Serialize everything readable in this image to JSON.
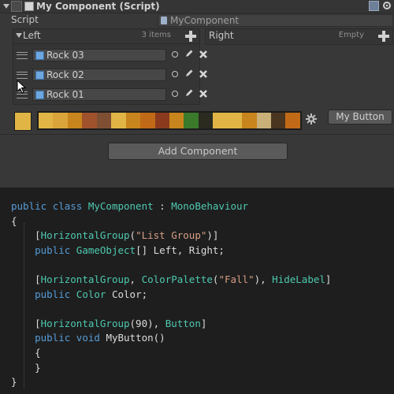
{
  "inspector": {
    "component_title": "My Component (Script)",
    "script_label": "Script",
    "script_value": "MyComponent",
    "left_list": {
      "title": "Left",
      "count": "3 items",
      "items": [
        {
          "label": "Rock 03"
        },
        {
          "label": "Rock 02"
        },
        {
          "label": "Rock 01"
        }
      ]
    },
    "right_list": {
      "title": "Right",
      "count": "Empty"
    },
    "color_field": {
      "value": "#e0b546"
    },
    "palette_colors": [
      "#e0b546",
      "#d9a43a",
      "#c8841d",
      "#a0522d",
      "#7f4f34",
      "#e0b546",
      "#c8841d",
      "#c06a18",
      "#8b3a1e",
      "#c8841d",
      "#3a7a2a",
      "#2b2b20",
      "#e0b546",
      "#e0b546",
      "#c8841d",
      "#c8b078",
      "#4a3520",
      "#c06a18"
    ],
    "my_button_label": "My Button",
    "add_component_label": "Add Component"
  },
  "code": {
    "lines": [
      [
        {
          "t": "public ",
          "c": "kw"
        },
        {
          "t": "class ",
          "c": "kw"
        },
        {
          "t": "MyComponent",
          "c": "ty"
        },
        {
          "t": " : ",
          "c": ""
        },
        {
          "t": "MonoBehaviour",
          "c": "ty"
        }
      ],
      [
        {
          "t": "{",
          "c": ""
        }
      ],
      [
        {
          "t": "    [",
          "c": ""
        },
        {
          "t": "HorizontalGroup",
          "c": "ty"
        },
        {
          "t": "(",
          "c": ""
        },
        {
          "t": "\"List Group\"",
          "c": "str"
        },
        {
          "t": ")]",
          "c": ""
        }
      ],
      [
        {
          "t": "    ",
          "c": ""
        },
        {
          "t": "public ",
          "c": "kw"
        },
        {
          "t": "GameObject",
          "c": "ty"
        },
        {
          "t": "[] Left, Right;",
          "c": ""
        }
      ],
      [
        {
          "t": "",
          "c": ""
        }
      ],
      [
        {
          "t": "    [",
          "c": ""
        },
        {
          "t": "HorizontalGroup",
          "c": "ty"
        },
        {
          "t": ", ",
          "c": ""
        },
        {
          "t": "ColorPalette",
          "c": "ty"
        },
        {
          "t": "(",
          "c": ""
        },
        {
          "t": "\"Fall\"",
          "c": "str"
        },
        {
          "t": "), ",
          "c": ""
        },
        {
          "t": "HideLabel",
          "c": "ty"
        },
        {
          "t": "]",
          "c": ""
        }
      ],
      [
        {
          "t": "    ",
          "c": ""
        },
        {
          "t": "public ",
          "c": "kw"
        },
        {
          "t": "Color",
          "c": "ty"
        },
        {
          "t": " Color;",
          "c": ""
        }
      ],
      [
        {
          "t": "",
          "c": ""
        }
      ],
      [
        {
          "t": "    [",
          "c": ""
        },
        {
          "t": "HorizontalGroup",
          "c": "ty"
        },
        {
          "t": "(90), ",
          "c": ""
        },
        {
          "t": "Button",
          "c": "ty"
        },
        {
          "t": "]",
          "c": ""
        }
      ],
      [
        {
          "t": "    ",
          "c": ""
        },
        {
          "t": "public ",
          "c": "kw"
        },
        {
          "t": "void ",
          "c": "kw"
        },
        {
          "t": "MyButton()",
          "c": ""
        }
      ],
      [
        {
          "t": "    {",
          "c": ""
        }
      ],
      [
        {
          "t": "    }",
          "c": ""
        }
      ],
      [
        {
          "t": "}",
          "c": ""
        }
      ]
    ]
  }
}
